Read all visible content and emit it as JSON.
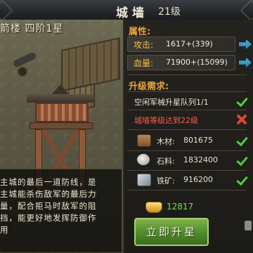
{
  "header": {
    "title": "城墙",
    "level": "21级"
  },
  "scene": {
    "building_name": "箭楼 四阶1星",
    "description": "主城的最后一道防线，是\n主城能杀伤敌军的最后力\n量，配合拒马时敌军的阻\n挡，能更好地发挥防御作\n用"
  },
  "attributes": {
    "label": "属性:",
    "rows": [
      {
        "name": "攻击:",
        "value": "1617+(339)"
      },
      {
        "name": "血量:",
        "value": "71900+(15099)"
      }
    ]
  },
  "requirements": {
    "label": "升级需求:",
    "conditions": [
      {
        "text": "空闲军械升星队列1/1",
        "status": "ok"
      },
      {
        "text": "城墙等级达到22级",
        "status": "fail"
      }
    ],
    "resources": [
      {
        "icon": "wood-icon",
        "name": "木材:",
        "value": "801675",
        "status": "ok"
      },
      {
        "icon": "stone-icon",
        "name": "石料:",
        "value": "1832400",
        "status": "ok"
      },
      {
        "icon": "iron-icon",
        "name": "铁矿:",
        "value": "916200",
        "status": "ok"
      }
    ]
  },
  "gold": {
    "amount": "12817",
    "icon": "gold-ingot-icon"
  },
  "actions": {
    "upgrade_label": "立即升星"
  },
  "colors": {
    "section": "#e8a33a",
    "ok": "#4fcf3a",
    "fail": "#e0452e",
    "gold_text": "#6fe04a"
  }
}
